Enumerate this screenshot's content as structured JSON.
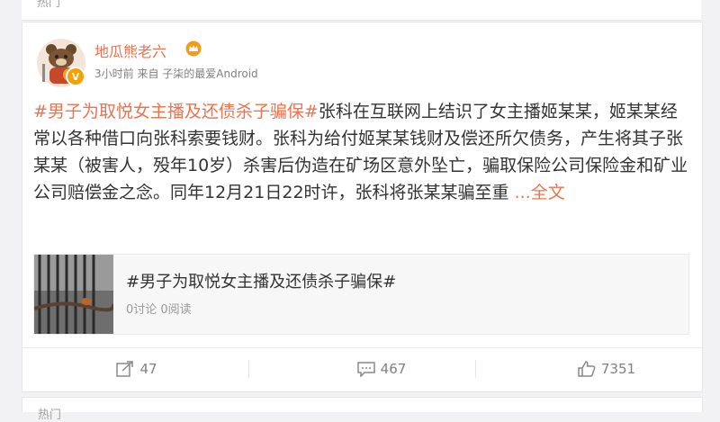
{
  "top_label": "热门",
  "post": {
    "username": "地瓜熊老六",
    "meta": "3小时前 来自 子柒的最爱Android",
    "topic": "#男子为取悦女主播及还债杀子骗保#",
    "body": "张科在互联网上结识了女主播姬某某，姬某某经常以各种借口向张科索要钱财。张科为给付姬某某钱财及偿还所欠债务，产生将其子张某某（被害人，殁年10岁）杀害后伪造在矿场区意外坠亡，骗取保险公司保险金和矿业公司赔偿金之念。同年12月21日22时许，张科将张某某骗至重 ",
    "more": "...全文",
    "verified_badge": "V"
  },
  "link_card": {
    "title": "#男子为取悦女主播及还债杀子骗保#",
    "stats": "0讨论 0阅读"
  },
  "actions": {
    "repost": "47",
    "comment": "467",
    "like": "7351"
  },
  "bottom_label": "热门",
  "colors": {
    "accent": "#eb7350",
    "verified": "#f7a100",
    "text": "#333333",
    "muted": "#808080"
  },
  "icons": [
    "repost-icon",
    "comment-icon",
    "like-icon",
    "crown-icon",
    "verified-badge-icon"
  ]
}
